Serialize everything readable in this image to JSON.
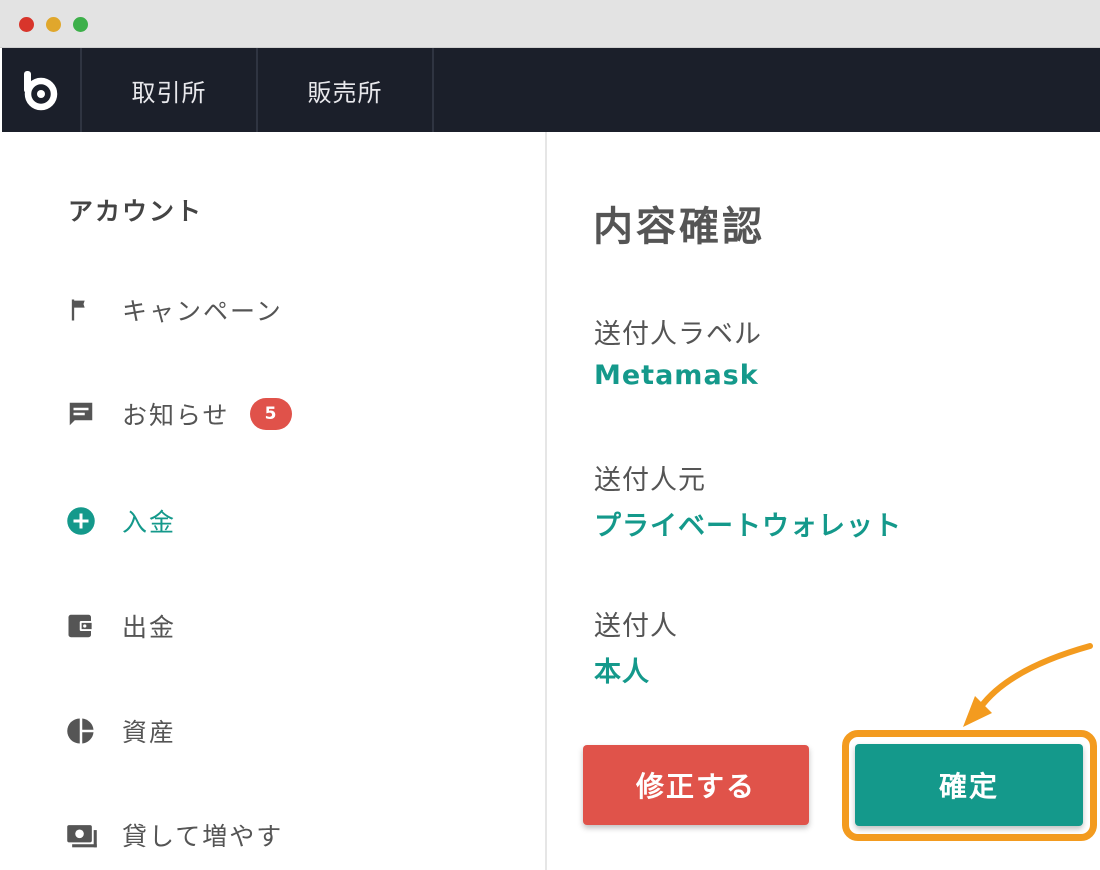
{
  "window": {
    "controls": [
      "close",
      "minimize",
      "maximize"
    ]
  },
  "header": {
    "logo": "b-logo-icon",
    "tabs": [
      {
        "label": "取引所"
      },
      {
        "label": "販売所"
      }
    ]
  },
  "sidebar": {
    "heading": "アカウント",
    "items": [
      {
        "label": "キャンペーン",
        "icon": "flag-icon",
        "active": false
      },
      {
        "label": "お知らせ",
        "icon": "message-icon",
        "active": false,
        "badge": "5"
      },
      {
        "label": "入金",
        "icon": "plus-circle-icon",
        "active": true
      },
      {
        "label": "出金",
        "icon": "wallet-icon",
        "active": false
      },
      {
        "label": "資産",
        "icon": "pie-chart-icon",
        "active": false
      },
      {
        "label": "貸して増やす",
        "icon": "money-icon",
        "active": false
      }
    ]
  },
  "main": {
    "title": "内容確認",
    "fields": [
      {
        "label": "送付人ラベル",
        "value": "Metamask"
      },
      {
        "label": "送付人元",
        "value": "プライベートウォレット"
      },
      {
        "label": "送付人",
        "value": "本人"
      }
    ],
    "edit_button": "修正する",
    "confirm_button": "確定"
  },
  "colors": {
    "accent": "#14998b",
    "danger": "#e0534a",
    "highlight": "#f39b1f",
    "header_bg": "#1b1f2a"
  }
}
